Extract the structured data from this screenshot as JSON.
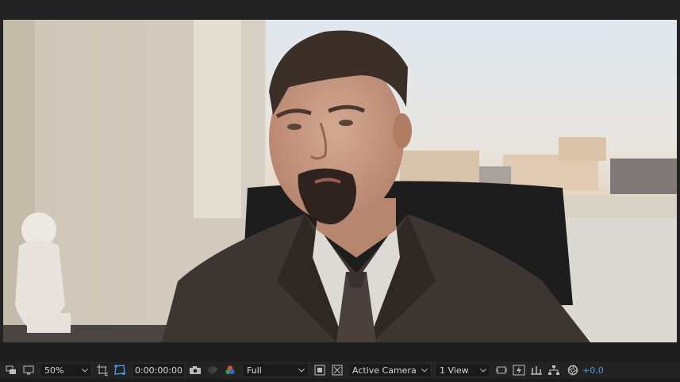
{
  "viewer": {
    "magnification": "50%",
    "timecode": "0:00:00:00",
    "resolution": "Full",
    "camera": "Active Camera",
    "view_layout": "1 View",
    "exposure": "+0.0"
  },
  "icons": {
    "always_preview": "overlapping-windows-icon",
    "monitor": "monitor-icon",
    "grid_guides": "grid-guides-icon",
    "mask_visibility": "mask-path-icon",
    "snapshot": "camera-icon",
    "show_snapshot": "show-snapshot-icon",
    "channels": "rgb-channels-icon",
    "region_of_interest": "region-of-interest-icon",
    "transparency_grid": "checkerboard-icon",
    "draft_3d": "draft-3d-icon",
    "fast_preview": "fast-preview-icon",
    "timeline": "timeline-icon",
    "flowchart": "flowchart-icon",
    "reset_exposure": "reset-exposure-icon"
  },
  "colors": {
    "panel": "#232323",
    "field": "#1a1a1a",
    "accent": "#4a9bf0"
  }
}
